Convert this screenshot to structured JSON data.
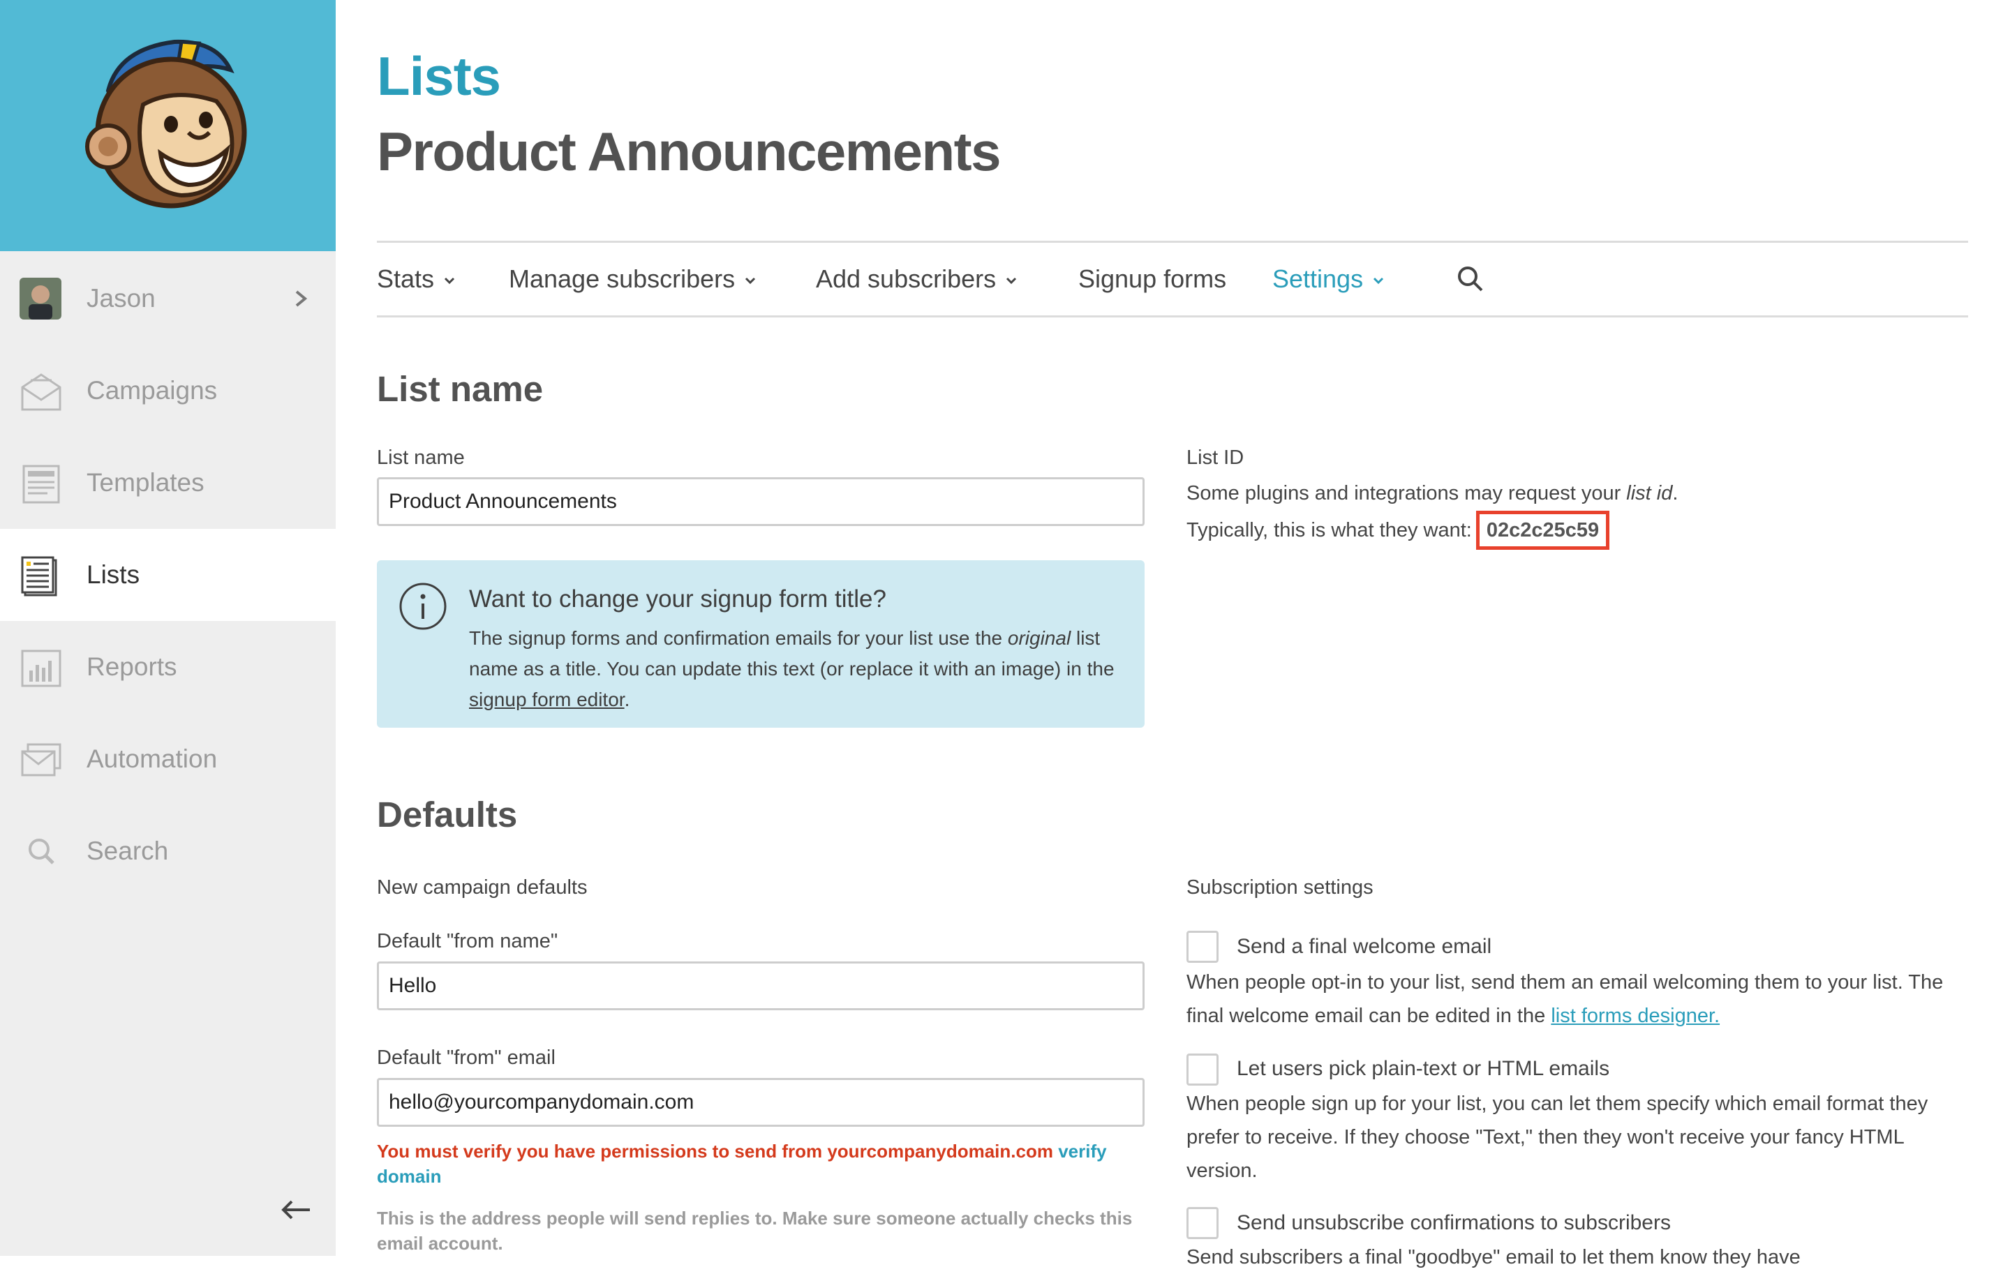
{
  "sidebar": {
    "user": {
      "name": "Jason"
    },
    "items": [
      {
        "label": "Campaigns",
        "icon": "envelope-icon"
      },
      {
        "label": "Templates",
        "icon": "template-icon"
      },
      {
        "label": "Lists",
        "icon": "list-icon",
        "active": true
      },
      {
        "label": "Reports",
        "icon": "bar-chart-icon"
      },
      {
        "label": "Automation",
        "icon": "automation-icon"
      },
      {
        "label": "Search",
        "icon": "search-icon"
      }
    ]
  },
  "header": {
    "breadcrumb": "Lists",
    "title": "Product Announcements"
  },
  "subnav": {
    "tabs": [
      {
        "label": "Stats",
        "has_caret": true
      },
      {
        "label": "Manage subscribers",
        "has_caret": true
      },
      {
        "label": "Add subscribers",
        "has_caret": true
      },
      {
        "label": "Signup forms",
        "has_caret": false
      },
      {
        "label": "Settings",
        "has_caret": true,
        "active": true
      }
    ]
  },
  "list_name_section": {
    "heading": "List name",
    "field_label": "List name",
    "field_value": "Product Announcements",
    "info": {
      "title": "Want to change your signup form title?",
      "text_1": "The signup forms and confirmation emails for your list use the ",
      "text_italic": "original",
      "text_2": " list name as a title. You can update this text (or replace it with an image) in the ",
      "link": "signup form editor",
      "text_3": "."
    },
    "list_id": {
      "label": "List ID",
      "line1_a": "Some plugins and integrations may request your ",
      "line1_italic": "list id",
      "line1_b": ".",
      "line2": "Typically, this is what they want:",
      "value": "02c2c25c59"
    }
  },
  "defaults_section": {
    "heading": "Defaults",
    "campaign_defaults_label": "New campaign defaults",
    "from_name_label": "Default \"from name\"",
    "from_name_value": "Hello",
    "from_email_label": "Default \"from\" email",
    "from_email_value": "hello@yourcompanydomain.com",
    "warning_text": "You must verify you have permissions to send from yourcompanydomain.com ",
    "warning_link": "verify domain",
    "help_text": "This is the address people will send replies to. Make sure someone actually checks this email account.",
    "subscription_label": "Subscription settings",
    "options": [
      {
        "label": "Send a final welcome email",
        "desc_1": "When people opt-in to your list, send them an email welcoming them to your list. The final welcome email can be edited in the ",
        "desc_link": "list forms designer.",
        "checked": false
      },
      {
        "label": "Let users pick plain-text or HTML emails",
        "desc_1": "When people sign up for your list, you can let them specify which email format they prefer to receive. If they choose \"Text,\" then they won't receive your fancy HTML version.",
        "checked": false
      },
      {
        "label": "Send unsubscribe confirmations to subscribers",
        "desc_1": "Send subscribers a final \"goodbye\" email to let them know they have",
        "checked": false
      }
    ]
  },
  "colors": {
    "brand_blue": "#52bad5",
    "link_blue": "#2a9dba",
    "warning_red": "#d43a1c",
    "highlight_red": "#e8412c",
    "info_bg": "#cfeaf2"
  }
}
